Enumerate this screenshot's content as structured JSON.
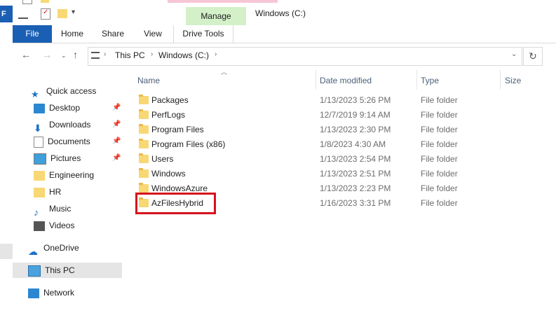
{
  "window": {
    "title": "Windows (C:)",
    "contextual_tab": "Manage",
    "left_strip_letter": "F"
  },
  "ribbon": {
    "tabs": [
      "File",
      "Home",
      "Share",
      "View",
      "Drive Tools"
    ]
  },
  "address": {
    "crumbs": [
      "This PC",
      "Windows (C:)"
    ]
  },
  "nav_pane": {
    "items": [
      {
        "label": "Quick access",
        "icon": "star-icon"
      },
      {
        "label": "Desktop",
        "icon": "desktop-icon",
        "pinned": true
      },
      {
        "label": "Downloads",
        "icon": "download-icon",
        "pinned": true
      },
      {
        "label": "Documents",
        "icon": "document-icon",
        "pinned": true
      },
      {
        "label": "Pictures",
        "icon": "pictures-icon",
        "pinned": true
      },
      {
        "label": "Engineering",
        "icon": "folder-icon"
      },
      {
        "label": "HR",
        "icon": "folder-icon"
      },
      {
        "label": "Music",
        "icon": "music-icon"
      },
      {
        "label": "Videos",
        "icon": "video-icon"
      },
      {
        "label": "OneDrive",
        "icon": "cloud-icon"
      },
      {
        "label": "This PC",
        "icon": "pc-icon",
        "selected": true
      },
      {
        "label": "Network",
        "icon": "network-icon"
      }
    ]
  },
  "file_list": {
    "columns": [
      "Name",
      "Date modified",
      "Type",
      "Size"
    ],
    "rows": [
      {
        "name": "Packages",
        "date": "1/13/2023 5:26 PM",
        "type": "File folder"
      },
      {
        "name": "PerfLogs",
        "date": "12/7/2019 9:14 AM",
        "type": "File folder"
      },
      {
        "name": "Program Files",
        "date": "1/13/2023 2:30 PM",
        "type": "File folder"
      },
      {
        "name": "Program Files (x86)",
        "date": "1/8/2023 4:30 AM",
        "type": "File folder"
      },
      {
        "name": "Users",
        "date": "1/13/2023 2:54 PM",
        "type": "File folder"
      },
      {
        "name": "Windows",
        "date": "1/13/2023 2:51 PM",
        "type": "File folder"
      },
      {
        "name": "WindowsAzure",
        "date": "1/13/2023 2:23 PM",
        "type": "File folder"
      },
      {
        "name": "AzFilesHybrid",
        "date": "1/16/2023 3:31 PM",
        "type": "File folder",
        "highlighted": true
      }
    ]
  },
  "colors": {
    "file_tab": "#1a5fb4",
    "manage_tab": "#d4f0c9",
    "highlight_box": "#d6111b",
    "selected_nav": "#e5e5e5",
    "folder": "#f8d775"
  }
}
